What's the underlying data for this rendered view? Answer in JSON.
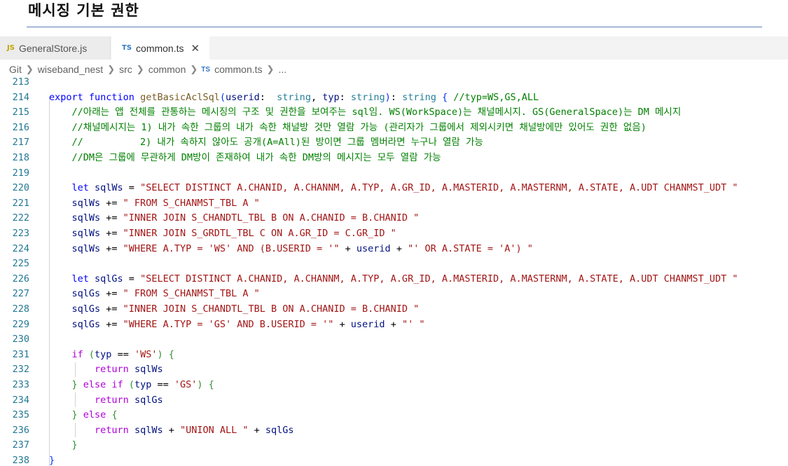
{
  "page_heading": "메시징 기본 권한",
  "tabs": [
    {
      "badge": "JS",
      "label": "GeneralStore.js",
      "active": false
    },
    {
      "badge": "TS",
      "label": "common.ts",
      "active": true,
      "close": "✕"
    }
  ],
  "breadcrumb": {
    "parts": [
      "Git",
      "wiseband_nest",
      "src",
      "common"
    ],
    "file_badge": "TS",
    "file": "common.ts",
    "trail": "..."
  },
  "code_lines": [
    {
      "n": "213",
      "tokens": []
    },
    {
      "n": "214",
      "tokens": [
        [
          "kw",
          "export "
        ],
        [
          "kw",
          "function "
        ],
        [
          "fn",
          "getBasicAclSql"
        ],
        [
          "br1",
          "("
        ],
        [
          "var",
          "userid"
        ],
        [
          "",
          "："
        ],
        [
          "type",
          " string"
        ],
        [
          "",
          ", "
        ],
        [
          "var",
          "typ"
        ],
        [
          "",
          ": "
        ],
        [
          "type",
          "string"
        ],
        [
          "br1",
          ")"
        ],
        [
          "",
          ": "
        ],
        [
          "type",
          "string "
        ],
        [
          "br1",
          "{ "
        ],
        [
          "cmt",
          "//typ=WS,GS,ALL"
        ]
      ]
    },
    {
      "n": "215",
      "tokens": [
        [
          "",
          "    "
        ],
        [
          "cmt",
          "//아래는 앱 전체를 관통하는 메시징의 구조 및 권한을 보여주는 sql임. WS(WorkSpace)는 채널메시지. GS(GeneralSpace)는 DM 메시지"
        ]
      ]
    },
    {
      "n": "216",
      "tokens": [
        [
          "",
          "    "
        ],
        [
          "cmt",
          "//채널메시지는 1) 내가 속한 그룹의 내가 속한 채널방 것만 열람 가능 (관리자가 그룹에서 제외시키면 채널방에만 있어도 권한 없음)"
        ]
      ]
    },
    {
      "n": "217",
      "tokens": [
        [
          "",
          "    "
        ],
        [
          "cmt",
          "//          2) 내가 속하지 않아도 공개(A=All)된 방이면 그룹 멤버라면 누구나 열람 가능"
        ]
      ]
    },
    {
      "n": "218",
      "tokens": [
        [
          "",
          "    "
        ],
        [
          "cmt",
          "//DM은 그룹에 무관하게 DM방이 존재하여 내가 속한 DM방의 메시지는 모두 열람 가능"
        ]
      ]
    },
    {
      "n": "219",
      "tokens": []
    },
    {
      "n": "220",
      "tokens": [
        [
          "",
          "    "
        ],
        [
          "kw",
          "let "
        ],
        [
          "var",
          "sqlWs"
        ],
        [
          "",
          " = "
        ],
        [
          "str",
          "\"SELECT DISTINCT A.CHANID, A.CHANNM, A.TYP, A.GR_ID, A.MASTERID, A.MASTERNM, A.STATE, A.UDT CHANMST_UDT \""
        ]
      ]
    },
    {
      "n": "221",
      "tokens": [
        [
          "",
          "    "
        ],
        [
          "var",
          "sqlWs"
        ],
        [
          "",
          " += "
        ],
        [
          "str",
          "\" FROM S_CHANMST_TBL A \""
        ]
      ]
    },
    {
      "n": "222",
      "tokens": [
        [
          "",
          "    "
        ],
        [
          "var",
          "sqlWs"
        ],
        [
          "",
          " += "
        ],
        [
          "str",
          "\"INNER JOIN S_CHANDTL_TBL B ON A.CHANID = B.CHANID \""
        ]
      ]
    },
    {
      "n": "223",
      "tokens": [
        [
          "",
          "    "
        ],
        [
          "var",
          "sqlWs"
        ],
        [
          "",
          " += "
        ],
        [
          "str",
          "\"INNER JOIN S_GRDTL_TBL C ON A.GR_ID = C.GR_ID \""
        ]
      ]
    },
    {
      "n": "224",
      "tokens": [
        [
          "",
          "    "
        ],
        [
          "var",
          "sqlWs"
        ],
        [
          "",
          " += "
        ],
        [
          "str",
          "\"WHERE A.TYP = 'WS' AND (B.USERID = '\""
        ],
        [
          "",
          " + "
        ],
        [
          "var",
          "userid"
        ],
        [
          "",
          " + "
        ],
        [
          "str",
          "\"' OR A.STATE = 'A') \""
        ]
      ]
    },
    {
      "n": "225",
      "tokens": []
    },
    {
      "n": "226",
      "tokens": [
        [
          "",
          "    "
        ],
        [
          "kw",
          "let "
        ],
        [
          "var",
          "sqlGs"
        ],
        [
          "",
          " = "
        ],
        [
          "str",
          "\"SELECT DISTINCT A.CHANID, A.CHANNM, A.TYP, A.GR_ID, A.MASTERID, A.MASTERNM, A.STATE, A.UDT CHANMST_UDT \""
        ]
      ]
    },
    {
      "n": "227",
      "tokens": [
        [
          "",
          "    "
        ],
        [
          "var",
          "sqlGs"
        ],
        [
          "",
          " += "
        ],
        [
          "str",
          "\" FROM S_CHANMST_TBL A \""
        ]
      ]
    },
    {
      "n": "228",
      "tokens": [
        [
          "",
          "    "
        ],
        [
          "var",
          "sqlGs"
        ],
        [
          "",
          " += "
        ],
        [
          "str",
          "\"INNER JOIN S_CHANDTL_TBL B ON A.CHANID = B.CHANID \""
        ]
      ]
    },
    {
      "n": "229",
      "tokens": [
        [
          "",
          "    "
        ],
        [
          "var",
          "sqlGs"
        ],
        [
          "",
          " += "
        ],
        [
          "str",
          "\"WHERE A.TYP = 'GS' AND B.USERID = '\""
        ],
        [
          "",
          " + "
        ],
        [
          "var",
          "userid"
        ],
        [
          "",
          " + "
        ],
        [
          "str",
          "\"' \""
        ]
      ]
    },
    {
      "n": "230",
      "tokens": []
    },
    {
      "n": "231",
      "tokens": [
        [
          "",
          "    "
        ],
        [
          "ctl",
          "if "
        ],
        [
          "br2",
          "("
        ],
        [
          "var",
          "typ"
        ],
        [
          "",
          " == "
        ],
        [
          "str",
          "'WS'"
        ],
        [
          "br2",
          ")"
        ],
        [
          "",
          " "
        ],
        [
          "br2",
          "{"
        ]
      ]
    },
    {
      "n": "232",
      "tokens": [
        [
          "",
          "        "
        ],
        [
          "ctl",
          "return "
        ],
        [
          "var",
          "sqlWs"
        ]
      ]
    },
    {
      "n": "233",
      "tokens": [
        [
          "",
          "    "
        ],
        [
          "br2",
          "}"
        ],
        [
          "",
          " "
        ],
        [
          "ctl",
          "else if "
        ],
        [
          "br2",
          "("
        ],
        [
          "var",
          "typ"
        ],
        [
          "",
          " == "
        ],
        [
          "str",
          "'GS'"
        ],
        [
          "br2",
          ")"
        ],
        [
          "",
          " "
        ],
        [
          "br2",
          "{"
        ]
      ]
    },
    {
      "n": "234",
      "tokens": [
        [
          "",
          "        "
        ],
        [
          "ctl",
          "return "
        ],
        [
          "var",
          "sqlGs"
        ]
      ]
    },
    {
      "n": "235",
      "tokens": [
        [
          "",
          "    "
        ],
        [
          "br2",
          "}"
        ],
        [
          "",
          " "
        ],
        [
          "ctl",
          "else "
        ],
        [
          "br2",
          "{"
        ]
      ]
    },
    {
      "n": "236",
      "tokens": [
        [
          "",
          "        "
        ],
        [
          "ctl",
          "return "
        ],
        [
          "var",
          "sqlWs"
        ],
        [
          "",
          " + "
        ],
        [
          "str",
          "\"UNION ALL \""
        ],
        [
          "",
          " + "
        ],
        [
          "var",
          "sqlGs"
        ]
      ]
    },
    {
      "n": "237",
      "tokens": [
        [
          "",
          "    "
        ],
        [
          "br2",
          "}"
        ]
      ]
    },
    {
      "n": "238",
      "tokens": [
        [
          "br1",
          "}"
        ]
      ]
    }
  ]
}
